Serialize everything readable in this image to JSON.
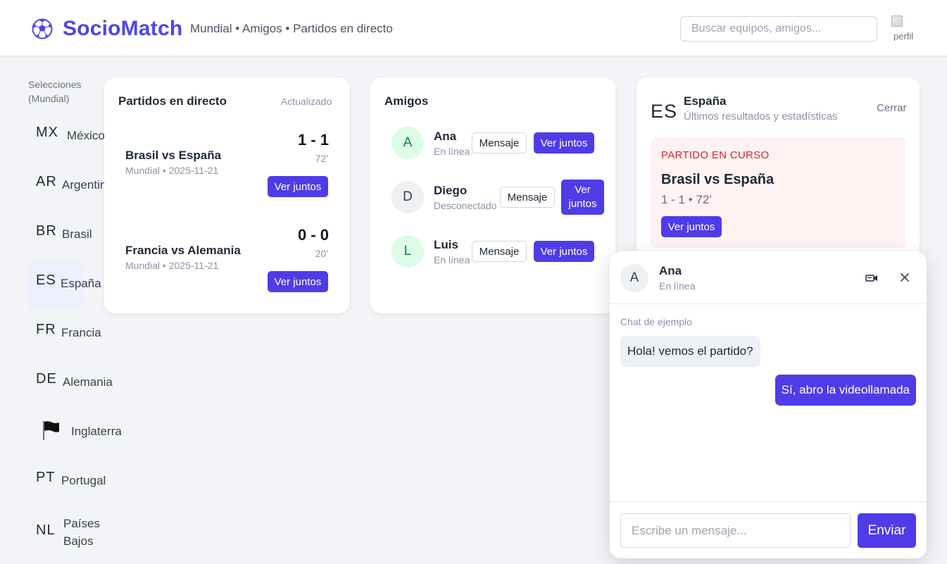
{
  "header": {
    "brand": "SocioMatch",
    "nav": "Mundial • Amigos • Partidos en directo",
    "search_placeholder": "Buscar equipos, amigos...",
    "avatar_alt": "perfil",
    "logo_icon": "soccer-ball-icon"
  },
  "sidebar": {
    "title": "Selecciones (Mundial)",
    "teams": [
      {
        "code": "MX",
        "name": "México"
      },
      {
        "code": "AR",
        "name": "Argentina"
      },
      {
        "code": "BR",
        "name": "Brasil"
      },
      {
        "code": "ES",
        "name": "España",
        "active": true
      },
      {
        "code": "FR",
        "name": "Francia"
      },
      {
        "code": "DE",
        "name": "Alemania"
      },
      {
        "code": "",
        "name": "Inglaterra",
        "icon": "black-flag-icon"
      },
      {
        "code": "PT",
        "name": "Portugal"
      },
      {
        "code": "NL",
        "name": "Países Bajos"
      }
    ]
  },
  "live": {
    "title": "Partidos en directo",
    "updated": "Actualizado",
    "matches": [
      {
        "teams": "Brasil vs España",
        "meta": "Mundial • 2025-11-21",
        "score": "1 - 1",
        "minute": "72'",
        "button": "Ver juntos"
      },
      {
        "teams": "Francia vs Alemania",
        "meta": "Mundial • 2025-11-21",
        "score": "0 - 0",
        "minute": "20'",
        "button": "Ver juntos"
      }
    ]
  },
  "friends": {
    "title": "Amigos",
    "list": [
      {
        "initial": "A",
        "name": "Ana",
        "status": "En línea",
        "message": "Mensaje",
        "watch": "Ver juntos"
      },
      {
        "initial": "D",
        "name": "Diego",
        "status": "Desconectado",
        "message": "Mensaje",
        "watch": "Ver juntos"
      },
      {
        "initial": "L",
        "name": "Luis",
        "status": "En línea",
        "message": "Mensaje",
        "watch": "Ver juntos"
      }
    ]
  },
  "country": {
    "code": "ES",
    "name": "España",
    "subtitle": "Últimos resultados y estadísticas",
    "close": "Cerrar",
    "live_label": "PARTIDO EN CURSO",
    "live_match": "Brasil vs España",
    "live_score": "1 - 1 • 72'",
    "button": "Ver juntos"
  },
  "chat": {
    "initial": "A",
    "name": "Ana",
    "status": "En línea",
    "label": "Chat de ejemplo",
    "messages": [
      {
        "from": "friend",
        "text": "Hola! vemos el partido?"
      },
      {
        "from": "me",
        "text": "Sí, abro la videollamada"
      }
    ],
    "input_placeholder": "Escribe un mensaje...",
    "send": "Enviar",
    "icons": [
      "video-call-icon",
      "close-icon"
    ]
  },
  "colors": {
    "accent": "#4f3ce8",
    "brand": "#4f46e5",
    "live_bg": "#fef2f2",
    "live_text": "#dc2626",
    "online_bg": "#dcfce7"
  }
}
